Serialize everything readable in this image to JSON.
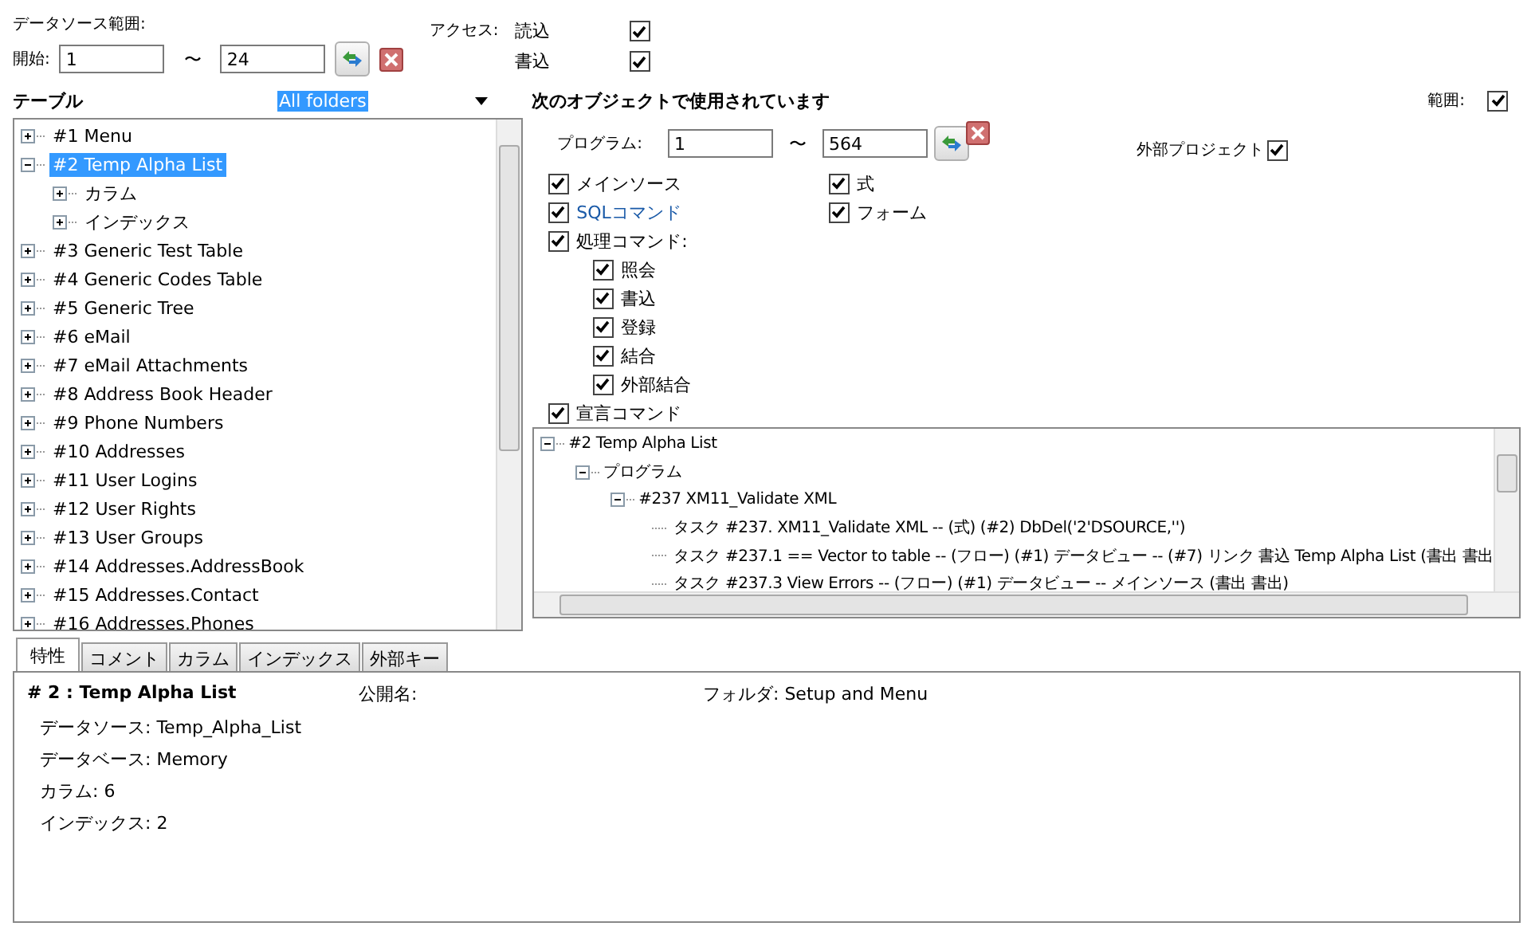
{
  "datasource_range": {
    "label": "データソース範囲:",
    "start_label": "開始:",
    "from": "1",
    "separator": "〜",
    "to": "24"
  },
  "access": {
    "label": "アクセス:",
    "options": [
      {
        "label": "読込",
        "checked": true
      },
      {
        "label": "書込",
        "checked": true
      }
    ]
  },
  "tables": {
    "title": "テーブル",
    "folder_dropdown": {
      "value": "All folders"
    },
    "items": [
      {
        "label": "#1 Menu",
        "expanded": false,
        "selected": false
      },
      {
        "label": "#2 Temp Alpha List",
        "expanded": true,
        "selected": true,
        "children": [
          {
            "label": "カラム",
            "expanded": false,
            "selected": false
          },
          {
            "label": "インデックス",
            "expanded": false,
            "selected": false
          }
        ]
      },
      {
        "label": "#3 Generic Test Table",
        "expanded": false,
        "selected": false
      },
      {
        "label": "#4 Generic Codes Table",
        "expanded": false,
        "selected": false
      },
      {
        "label": "#5 Generic Tree",
        "expanded": false,
        "selected": false
      },
      {
        "label": "#6 eMail",
        "expanded": false,
        "selected": false
      },
      {
        "label": "#7 eMail Attachments",
        "expanded": false,
        "selected": false
      },
      {
        "label": "#8 Address Book Header",
        "expanded": false,
        "selected": false
      },
      {
        "label": "#9 Phone Numbers",
        "expanded": false,
        "selected": false
      },
      {
        "label": "#10 Addresses",
        "expanded": false,
        "selected": false
      },
      {
        "label": "#11 User Logins",
        "expanded": false,
        "selected": false
      },
      {
        "label": "#12 User Rights",
        "expanded": false,
        "selected": false
      },
      {
        "label": "#13 User Groups",
        "expanded": false,
        "selected": false
      },
      {
        "label": "#14 Addresses.AddressBook",
        "expanded": false,
        "selected": false
      },
      {
        "label": "#15 Addresses.Contact",
        "expanded": false,
        "selected": false
      },
      {
        "label": "#16 Addresses.Phones",
        "expanded": false,
        "selected": false
      }
    ]
  },
  "usage": {
    "title": "次のオブジェクトで使用されています",
    "range_label": "範囲:",
    "range_checked": true,
    "program_label": "プログラム:",
    "from": "1",
    "separator": "〜",
    "to": "564",
    "external_project": {
      "label": "外部プロジェクト",
      "checked": true
    },
    "options_left": [
      {
        "label": "メインソース",
        "checked": true,
        "focused": false
      },
      {
        "label": "SQLコマンド",
        "checked": true,
        "focused": true
      },
      {
        "label": "処理コマンド:",
        "checked": true,
        "focused": false,
        "children": [
          {
            "label": "照会",
            "checked": true
          },
          {
            "label": "書込",
            "checked": true
          },
          {
            "label": "登録",
            "checked": true
          },
          {
            "label": "結合",
            "checked": true
          },
          {
            "label": "外部結合",
            "checked": true
          }
        ]
      },
      {
        "label": "宣言コマンド",
        "checked": true,
        "focused": false
      }
    ],
    "options_right": [
      {
        "label": "式",
        "checked": true
      },
      {
        "label": "フォーム",
        "checked": true
      }
    ],
    "results": [
      {
        "label": "#2 Temp Alpha List",
        "expanded": true,
        "children": [
          {
            "label": "プログラム",
            "expanded": true,
            "children": [
              {
                "label": "#237 XM11_Validate XML",
                "expanded": true,
                "children": [
                  {
                    "label": "タスク #237.  XM11_Validate XML -- (式) (#2) DbDel('2'DSOURCE,'')"
                  },
                  {
                    "label": "タスク #237.1  == Vector to table -- (フロー) (#1) データビュー -- (#7) リンク 書込 Temp Alpha List (書出 書出"
                  },
                  {
                    "label": "タスク #237.3  View Errors -- (フロー) (#1) データビュー -- メインソース (書出 書出)"
                  }
                ]
              }
            ]
          }
        ]
      }
    ]
  },
  "tabs": [
    {
      "label": "特性",
      "selected": true
    },
    {
      "label": "コメント",
      "selected": false
    },
    {
      "label": "カラム",
      "selected": false
    },
    {
      "label": "インデックス",
      "selected": false
    },
    {
      "label": "外部キー",
      "selected": false
    }
  ],
  "properties": {
    "heading": "# 2 : Temp Alpha List",
    "public_name": "公開名:",
    "folder": "フォルダ: Setup and Menu",
    "details": [
      "データソース: Temp_Alpha_List",
      "データベース: Memory",
      "カラム: 6",
      "インデックス: 2"
    ]
  }
}
